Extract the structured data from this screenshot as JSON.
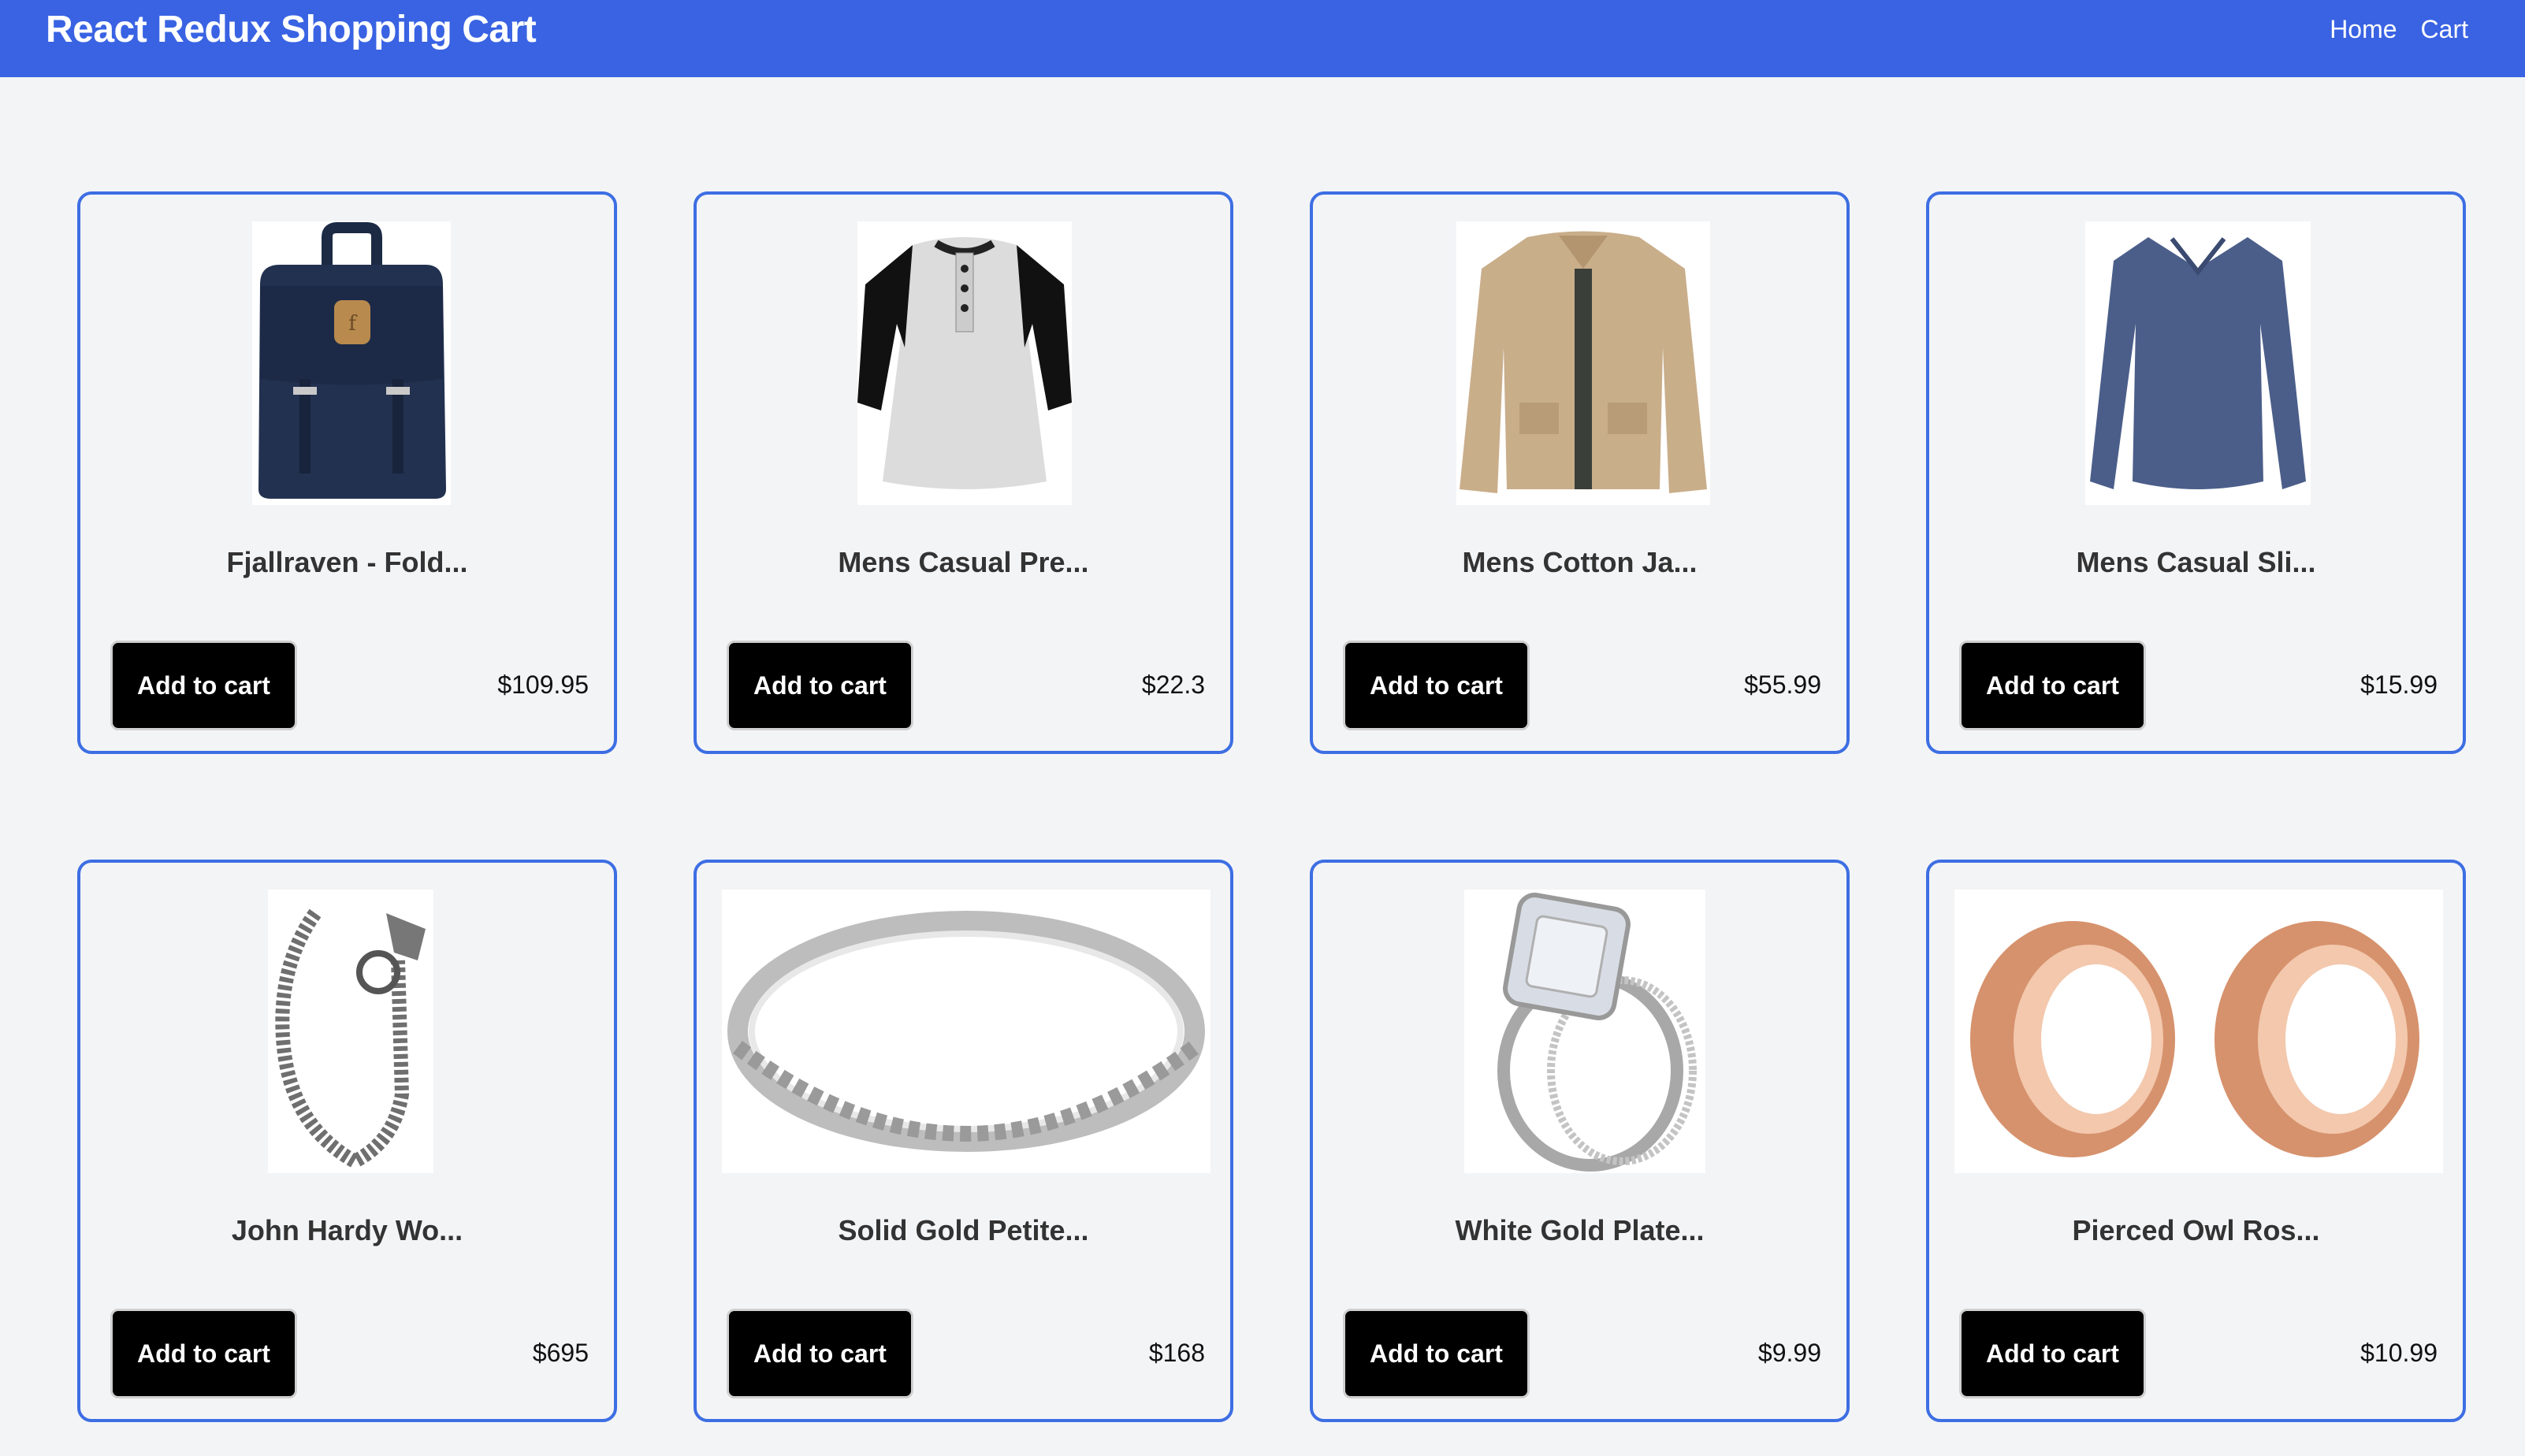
{
  "navbar": {
    "brand": "React Redux Shopping Cart",
    "links": [
      "Home",
      "Cart"
    ],
    "color": "#3963e3"
  },
  "products": [
    {
      "title": "Fjallraven - Fold...",
      "price": "$109.95",
      "button": "Add to cart",
      "image_icon": "backpack-image"
    },
    {
      "title": "Mens Casual Pre...",
      "price": "$22.3",
      "button": "Add to cart",
      "image_icon": "raglan-tshirt-image"
    },
    {
      "title": "Mens Cotton Ja...",
      "price": "$55.99",
      "button": "Add to cart",
      "image_icon": "cotton-jacket-image"
    },
    {
      "title": "Mens Casual Sli...",
      "price": "$15.99",
      "button": "Add to cart",
      "image_icon": "long-sleeve-shirt-image"
    },
    {
      "title": "John Hardy Wo...",
      "price": "$695",
      "button": "Add to cart",
      "image_icon": "chain-bracelet-image"
    },
    {
      "title": "Solid Gold Petite...",
      "price": "$168",
      "button": "Add to cart",
      "image_icon": "silver-bangle-image"
    },
    {
      "title": "White Gold Plate...",
      "price": "$9.99",
      "button": "Add to cart",
      "image_icon": "diamond-ring-image"
    },
    {
      "title": "Pierced Owl Ros...",
      "price": "$10.99",
      "button": "Add to cart",
      "image_icon": "rose-gold-plugs-image"
    }
  ],
  "colors": {
    "card_border": "#3d6ee3",
    "button_bg": "#000000",
    "page_bg": "#f3f4f6"
  }
}
